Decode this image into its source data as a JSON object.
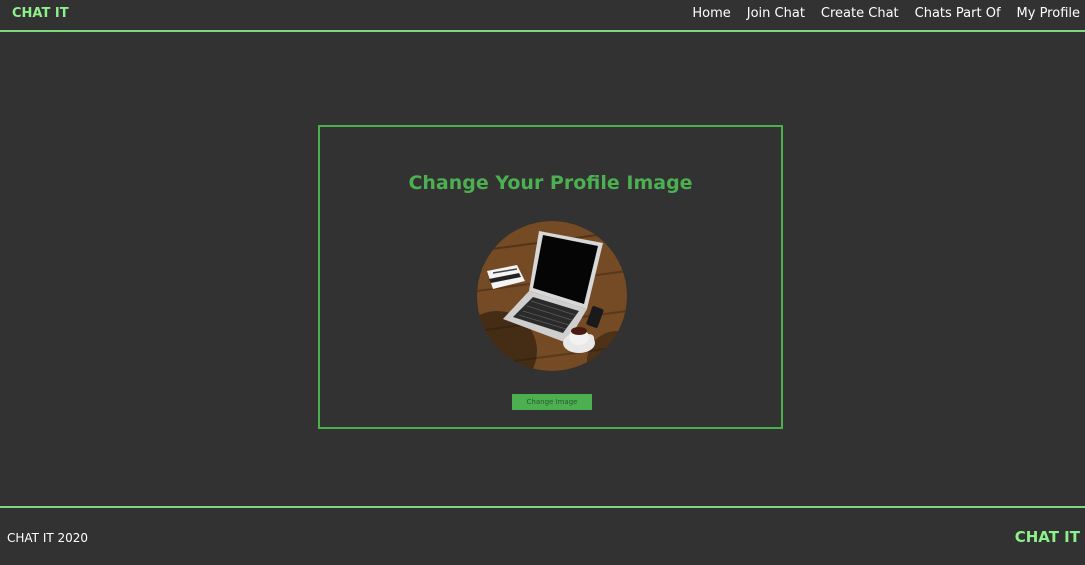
{
  "header": {
    "brand": "CHAT IT",
    "nav": [
      {
        "label": "Home"
      },
      {
        "label": "Join Chat"
      },
      {
        "label": "Create Chat"
      },
      {
        "label": "Chats Part Of"
      },
      {
        "label": "My Profile"
      }
    ]
  },
  "main": {
    "title": "Change Your Profile Image",
    "avatar_icon": "laptop-desk-photo",
    "button_label": "Change Image"
  },
  "footer": {
    "copyright": "CHAT IT 2020",
    "brand": "CHAT IT"
  },
  "colors": {
    "background": "#323232",
    "accent_green": "#4caf50",
    "brand_green": "#8ef08a",
    "divider_green": "#7fd97c"
  }
}
